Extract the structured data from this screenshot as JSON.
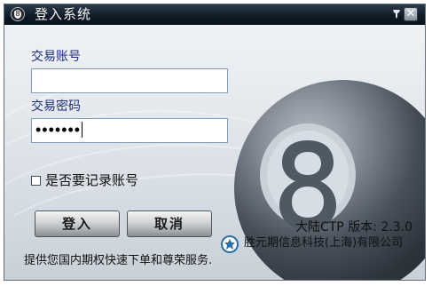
{
  "window": {
    "title": "登入系统"
  },
  "form": {
    "account_label": "交易账号",
    "account_value": "",
    "password_label": "交易密码",
    "password_value": "•••••••",
    "remember_label": "是否要记录账号",
    "remember_checked": false
  },
  "buttons": {
    "login": "登入",
    "cancel": "取消"
  },
  "footer": {
    "version": "大陆CTP 版本: 2.3.0",
    "company": "胜元期信息科技(上海)有限公司",
    "tagline": "提供您国内期权快速下单和尊荣服务."
  },
  "icons": {
    "app": "eight-ball-icon",
    "pin": "pin-icon",
    "close": "close-icon",
    "company": "company-logo-icon"
  },
  "colors": {
    "title_bar": "#0f1a25",
    "label_blue": "#1e2f7d",
    "background_gray": "#d7dde4"
  }
}
